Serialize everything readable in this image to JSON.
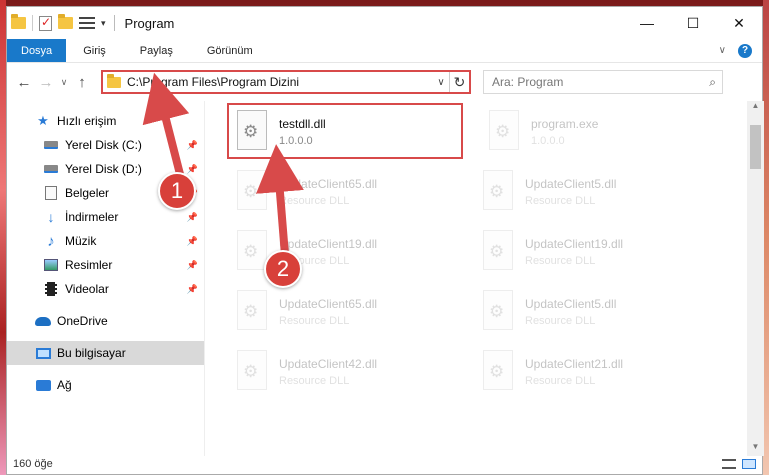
{
  "window": {
    "title": "Program",
    "controls": {
      "minimize": "—",
      "maximize": "☐",
      "close": "✕"
    }
  },
  "ribbon": {
    "tabs": [
      "Dosya",
      "Giriş",
      "Paylaş",
      "Görünüm"
    ],
    "collapse_glyph": "∨",
    "help_glyph": "?"
  },
  "address": {
    "path": "C:\\Program Files\\Program Dizini",
    "search_placeholder": "Ara: Program"
  },
  "sidebar": {
    "items": [
      {
        "label": "Hızlı erişim",
        "icon": "star-icon",
        "pinned": false
      },
      {
        "label": "Yerel Disk (C:)",
        "icon": "disk-icon",
        "pinned": true
      },
      {
        "label": "Yerel Disk (D:)",
        "icon": "disk-icon",
        "pinned": true
      },
      {
        "label": "Belgeler",
        "icon": "document-icon",
        "pinned": true
      },
      {
        "label": "İndirmeler",
        "icon": "download-icon",
        "pinned": true
      },
      {
        "label": "Müzik",
        "icon": "music-icon",
        "pinned": true
      },
      {
        "label": "Resimler",
        "icon": "pictures-icon",
        "pinned": true
      },
      {
        "label": "Videolar",
        "icon": "video-icon",
        "pinned": true
      },
      {
        "label": "OneDrive",
        "icon": "cloud-icon",
        "pinned": false
      },
      {
        "label": "Bu bilgisayar",
        "icon": "computer-icon",
        "pinned": false,
        "selected": true
      },
      {
        "label": "Ağ",
        "icon": "network-icon",
        "pinned": false
      }
    ]
  },
  "files": [
    {
      "name": "testdll.dll",
      "sub": "1.0.0.0",
      "faded": false
    },
    {
      "name": "program.exe",
      "sub": "1.0.0.0",
      "faded": true
    },
    {
      "name": "UpdateClient65.dll",
      "sub": "Resource DLL",
      "faded": true
    },
    {
      "name": "UpdateClient5.dll",
      "sub": "Resource DLL",
      "faded": true
    },
    {
      "name": "UpdateClient19.dll",
      "sub": "Resource DLL",
      "faded": true
    },
    {
      "name": "UpdateClient19.dll",
      "sub": "Resource DLL",
      "faded": true
    },
    {
      "name": "UpdateClient65.dll",
      "sub": "Resource DLL",
      "faded": true
    },
    {
      "name": "UpdateClient5.dll",
      "sub": "Resource DLL",
      "faded": true
    },
    {
      "name": "UpdateClient42.dll",
      "sub": "Resource DLL",
      "faded": true
    },
    {
      "name": "UpdateClient21.dll",
      "sub": "Resource DLL",
      "faded": true
    }
  ],
  "status": {
    "count": "160 öğe"
  },
  "annotations": {
    "badge1": "1",
    "badge2": "2"
  },
  "colors": {
    "accent": "#1979ca",
    "annotation": "#d84a4a"
  }
}
